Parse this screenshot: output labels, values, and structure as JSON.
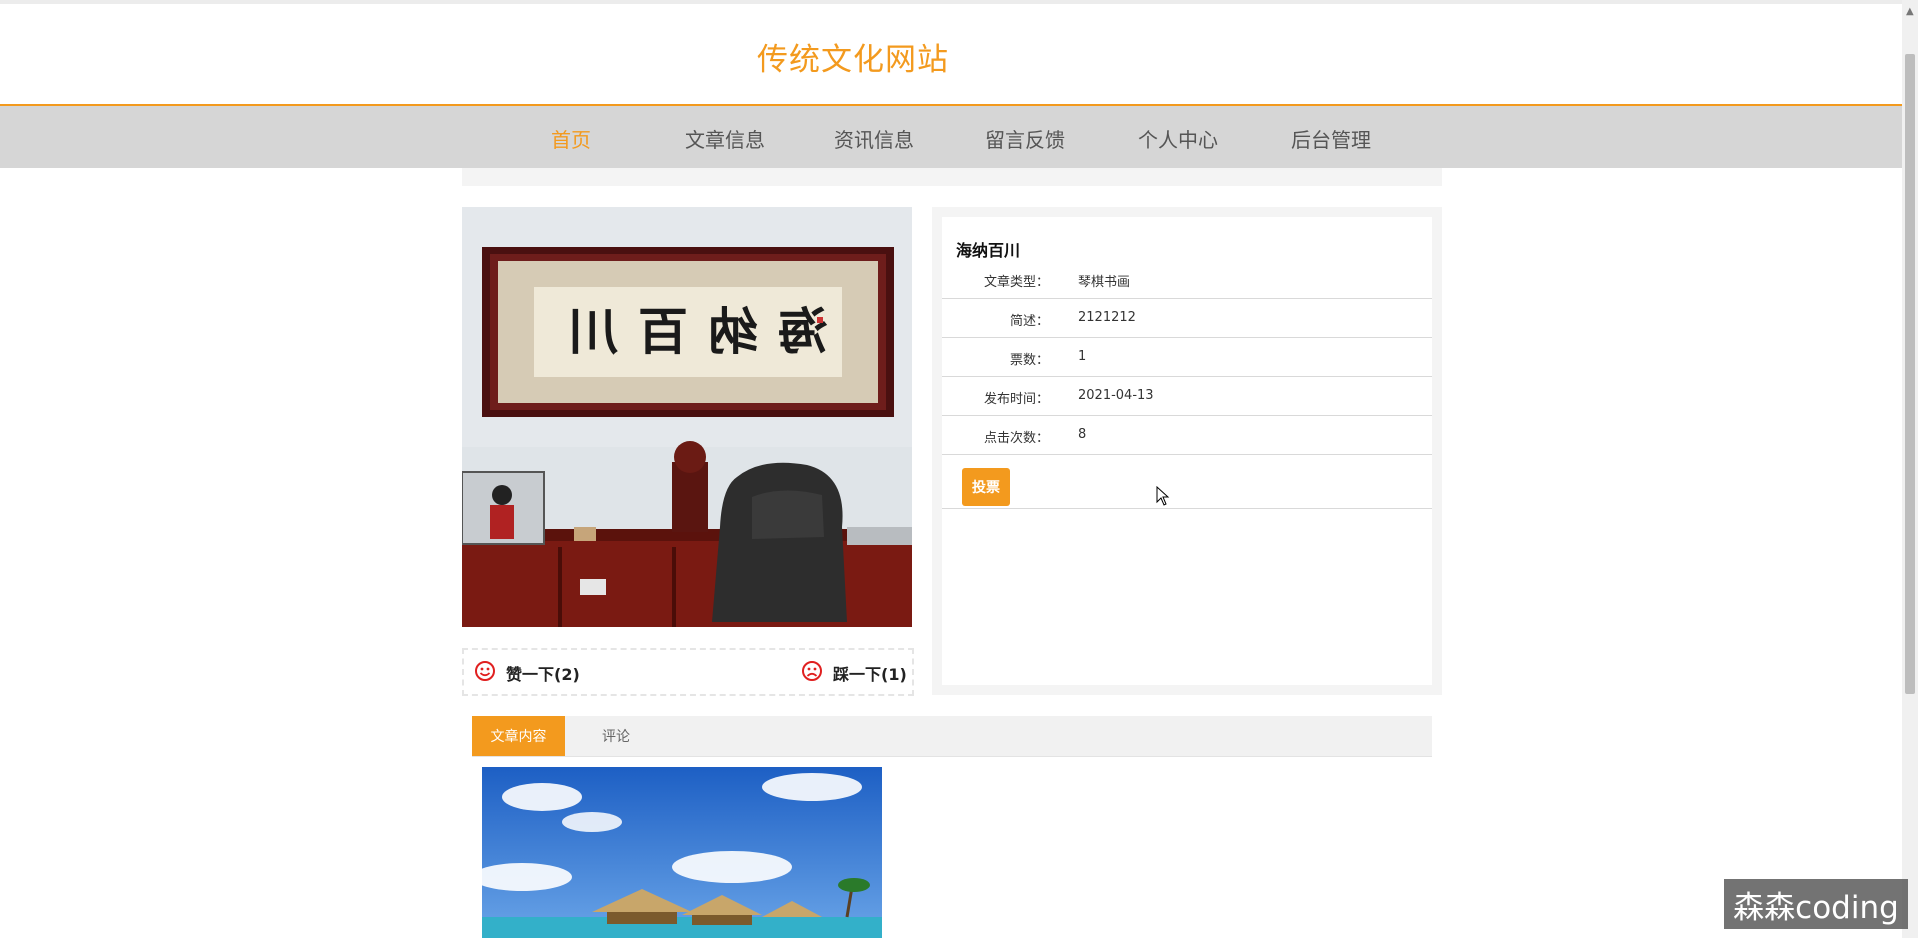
{
  "site": {
    "title": "传统文化网站"
  },
  "nav": {
    "items": [
      {
        "label": "首页",
        "active": true
      },
      {
        "label": "文章信息"
      },
      {
        "label": "资讯信息"
      },
      {
        "label": "留言反馈"
      },
      {
        "label": "个人中心"
      },
      {
        "label": "后台管理"
      }
    ]
  },
  "article": {
    "title": "海纳百川",
    "image_calligraphy": "海纳百川",
    "fields": [
      {
        "label": "文章类型：",
        "value": "琴棋书画"
      },
      {
        "label": "简述：",
        "value": "2121212"
      },
      {
        "label": "票数：",
        "value": "1"
      },
      {
        "label": "发布时间：",
        "value": "2021-04-13"
      },
      {
        "label": "点击次数：",
        "value": "8"
      }
    ],
    "vote_button": "投票",
    "like": "赞一下(2)",
    "dislike": "踩一下(1)"
  },
  "tabs": [
    {
      "label": "文章内容",
      "active": true
    },
    {
      "label": "评论"
    }
  ],
  "watermark": "森森coding",
  "colors": {
    "accent": "#f39a1e",
    "nav_bg": "#d6d6d6"
  },
  "icons": {
    "like": "smile-icon",
    "dislike": "frown-icon",
    "cursor": "mouse-pointer-icon"
  }
}
